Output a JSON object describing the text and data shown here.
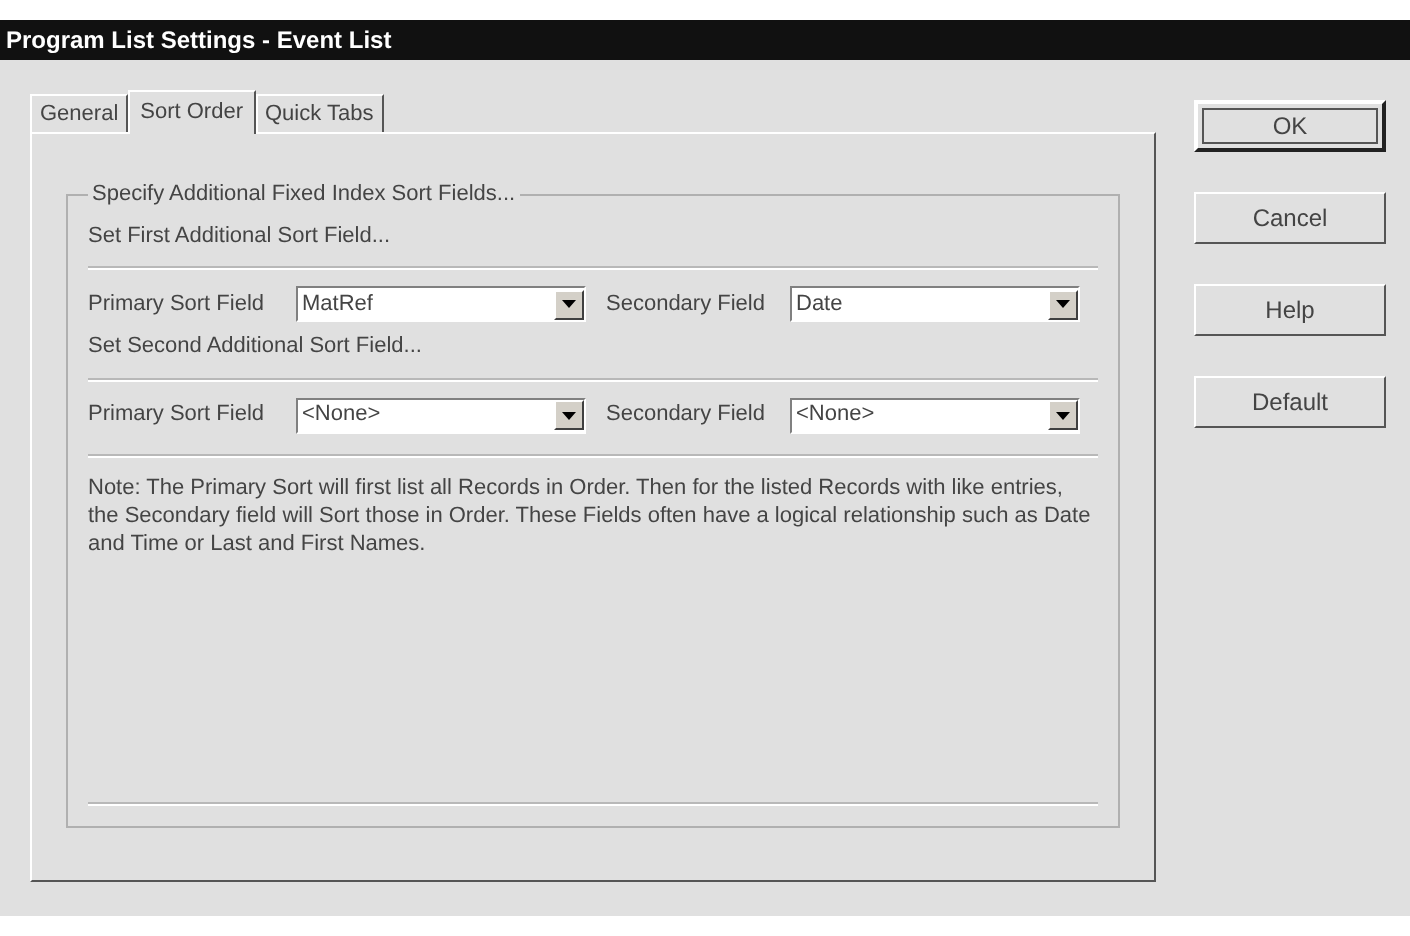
{
  "window": {
    "title": "Program List Settings - Event List"
  },
  "tabs": [
    {
      "label": "General",
      "selected": false
    },
    {
      "label": "Sort Order",
      "selected": true
    },
    {
      "label": "Quick Tabs",
      "selected": false
    }
  ],
  "group": {
    "title": "Specify Additional Fixed Index Sort Fields...",
    "sections": [
      {
        "heading": "Set First Additional Sort Field...",
        "primary_label": "Primary Sort Field",
        "primary_value": "MatRef",
        "secondary_label": "Secondary Field",
        "secondary_value": "Date"
      },
      {
        "heading": "Set Second Additional Sort Field...",
        "primary_label": "Primary Sort Field",
        "primary_value": "<None>",
        "secondary_label": "Secondary Field",
        "secondary_value": "<None>"
      }
    ],
    "note": "Note: The Primary Sort will first list all Records in Order. Then for the listed Records with like entries, the Secondary field will Sort those in Order.  These Fields often have a logical relationship such as Date and Time or Last and First Names."
  },
  "buttons": [
    {
      "label": "OK",
      "default": true
    },
    {
      "label": "Cancel",
      "default": false
    },
    {
      "label": "Help",
      "default": false
    },
    {
      "label": "Default",
      "default": false
    }
  ]
}
